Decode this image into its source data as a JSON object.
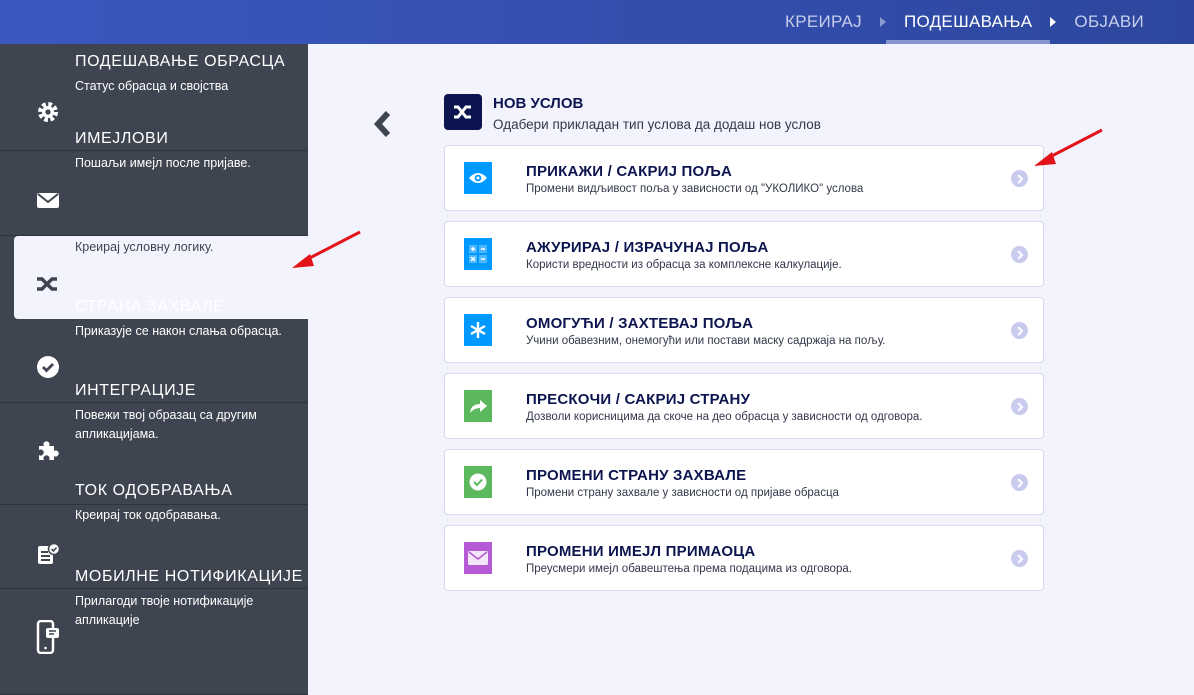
{
  "topnav": {
    "steps": [
      "КРЕИРАЈ",
      "ПОДЕШАВАЊА",
      "ОБЈАВИ"
    ],
    "active": "ПОДЕШАВАЊА"
  },
  "sidebar": {
    "items": [
      {
        "title": "ПОДЕШАВАЊЕ ОБРАСЦА",
        "desc": "Статус обрасца и својства",
        "icon": "gear-icon"
      },
      {
        "title": "ИМЕЈЛОВИ",
        "desc": "Пошаљи имејл после пријаве.",
        "icon": "envelope-icon"
      },
      {
        "title": "УСЛОВИ",
        "desc": "Креирај условну логику.",
        "icon": "shuffle-icon",
        "selected": true
      },
      {
        "title": "СТРАНА ЗАХВАЛЕ",
        "desc": "Приказује се након слања обрасца.",
        "icon": "check-circle-icon"
      },
      {
        "title": "ИНТЕГРАЦИЈЕ",
        "desc": "Повежи твој образац са другим апликацијама.",
        "icon": "puzzle-icon"
      },
      {
        "title": "ТОК ОДОБРАВАЊА",
        "desc": "Креирај ток одобравања.",
        "icon": "approval-icon"
      },
      {
        "title": "МОБИЛНЕ НОТИФИКАЦИЈЕ",
        "desc": "Прилагоди твоје нотификације апликације",
        "icon": "mobile-notification-icon"
      }
    ]
  },
  "main": {
    "title": "НОВ УСЛОВ",
    "subtitle": "Одабери прикладан тип услова да додаш нов услов",
    "cards": [
      {
        "title": "ПРИКАЖИ / САКРИЈ ПОЉА",
        "desc": "Промени видљивост поља у зависности од \"УКОЛИКО\" услова",
        "icon": "eye-icon",
        "color": "#0099ff"
      },
      {
        "title": "АЖУРИРАЈ / ИЗРАЧУНАЈ ПОЉА",
        "desc": "Користи вредности из обрасца за комплексне калкулације.",
        "icon": "calculator-icon",
        "color": "#0099ff"
      },
      {
        "title": "ОМОГУЋИ / ЗАХТЕВАЈ ПОЉА",
        "desc": "Учини обавезним, онемогући или постави маску садржаја на пољу.",
        "icon": "asterisk-icon",
        "color": "#0099ff"
      },
      {
        "title": "ПРЕСКОЧИ / САКРИЈ СТРАНУ",
        "desc": "Дозволи корисницима да скоче на део обрасца у зависности од одговора.",
        "icon": "forward-arrow-icon",
        "color": "#5cb85c"
      },
      {
        "title": "ПРОМЕНИ СТРАНУ ЗАХВАЛЕ",
        "desc": "Промени страну захвале у зависности од пријаве обрасца",
        "icon": "check-circle-icon",
        "color": "#5cb85c"
      },
      {
        "title": "ПРОМЕНИ ИМЕЈЛ ПРИМАОЦА",
        "desc": "Преусмери имејл обавештења према подацима из одговора.",
        "icon": "envelope-icon",
        "color": "#b55ad4"
      }
    ]
  }
}
